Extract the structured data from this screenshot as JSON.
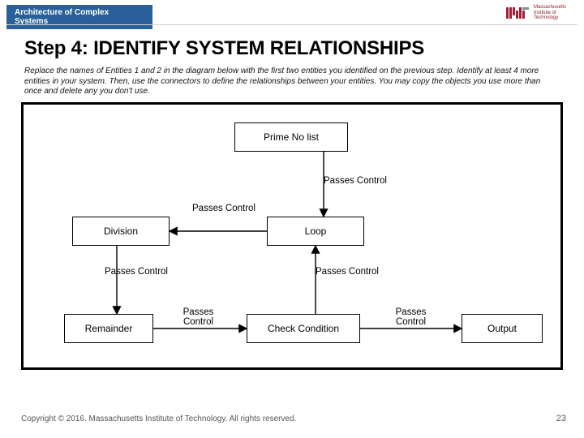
{
  "header": {
    "course": "Architecture of Complex Systems",
    "logo": {
      "institution": "Massachusetts",
      "line2": "Institute of",
      "line3": "Technology"
    }
  },
  "title": "Step 4: IDENTIFY SYSTEM RELATIONSHIPS",
  "instructions": "Replace the names of Entities 1 and 2 in the diagram below with the first two entities you identified on the previous step. Identify at least 4 more entities in your system. Then, use the connectors to define the relationships between your entities. You may copy the objects you use more than once and delete any you don't use.",
  "diagram": {
    "entities": {
      "prime": "Prime No list",
      "division": "Division",
      "loop": "Loop",
      "remainder": "Remainder",
      "check": "Check Condition",
      "output": "Output"
    },
    "labels": {
      "top_right": "Passes Control",
      "loop_left": "Passes Control",
      "div_down": "Passes Control",
      "check_loop": "Passes Control",
      "remainder_right": "Passes Control",
      "check_right": "Passes Control"
    }
  },
  "footer": {
    "copyright": "Copyright © 2016. Massachusetts Institute of Technology. All rights reserved.",
    "page": "23"
  }
}
